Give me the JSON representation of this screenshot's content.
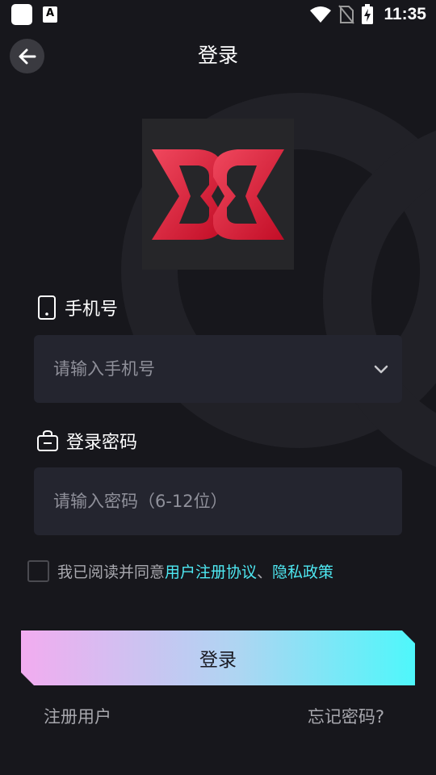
{
  "status_bar": {
    "time": "11:35",
    "notification_icon_letter": "A",
    "icons": [
      "app-notification-icon",
      "font-notification-icon",
      "wifi-icon",
      "no-sim-icon",
      "battery-charging-icon"
    ]
  },
  "header": {
    "title": "登录",
    "back_icon": "arrow-left-icon"
  },
  "logo": {
    "icon": "brand-logo",
    "color": "#e21c36"
  },
  "phone_field": {
    "label": "手机号",
    "icon": "phone-icon",
    "placeholder": "请输入手机号",
    "value": "",
    "dropdown_icon": "chevron-down-icon"
  },
  "password_field": {
    "label": "登录密码",
    "icon": "lock-icon",
    "placeholder": "请输入密码（6-12位）",
    "value": ""
  },
  "agreement": {
    "checked": false,
    "prefix": "我已阅读并同意",
    "user_agreement": "用户注册协议",
    "separator": "、",
    "privacy_policy": "隐私政策",
    "link_color": "#4ee8f2"
  },
  "login_button": {
    "label": "登录",
    "gradient": [
      "#f2acf0",
      "#aed5f2",
      "#4ef7fb"
    ]
  },
  "footer": {
    "register_label": "注册用户",
    "forgot_label": "忘记密码?"
  },
  "colors": {
    "background": "#17171c",
    "input_background": "#24252f",
    "muted_text": "#a8a8ae"
  }
}
